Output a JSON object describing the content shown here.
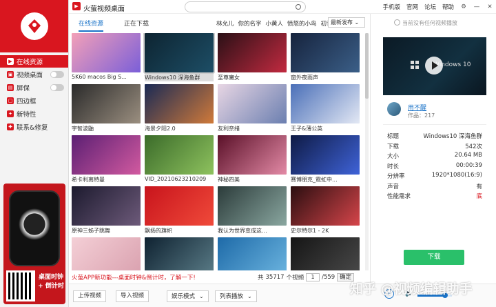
{
  "window": {
    "title": "火萤视频桌面",
    "search_placeholder": "",
    "nav": [
      "手机版",
      "官网",
      "论坛",
      "帮助"
    ],
    "controls": [
      "⚙",
      "—",
      "✕"
    ]
  },
  "sidebar": {
    "items": [
      {
        "label": "在线资源",
        "icon": "play-icon",
        "active": true,
        "toggle": false
      },
      {
        "label": "视频桌面",
        "icon": "video-icon",
        "active": false,
        "toggle": true
      },
      {
        "label": "屏保",
        "icon": "screensaver-icon",
        "active": false,
        "toggle": true
      },
      {
        "label": "四边框",
        "icon": "frame-icon",
        "active": false,
        "toggle": false
      },
      {
        "label": "新特性",
        "icon": "lightbulb-icon",
        "active": false,
        "toggle": false
      },
      {
        "label": "联系&修复",
        "icon": "wrench-icon",
        "active": false,
        "toggle": false
      }
    ],
    "promo_text": "桌面时钟 + 倒计时"
  },
  "tabs": {
    "items": [
      "在线资源",
      "正在下载"
    ],
    "authors": [
      "林允儿",
      "你的名字",
      "小黄人",
      "愤怒的小鸟",
      "初音"
    ],
    "sort": "最新发布"
  },
  "grid": {
    "tiles": [
      {
        "label": "5K60 macos Big S...",
        "colors": [
          "#f3a0b8",
          "#7b5fd8"
        ]
      },
      {
        "label": "Windows10 深海鱼群",
        "colors": [
          "#0d2431",
          "#1d4e66"
        ],
        "selected": true
      },
      {
        "label": "至尊魔女",
        "colors": [
          "#2a1016",
          "#c22a40"
        ]
      },
      {
        "label": "窗外夜雨声",
        "colors": [
          "#16233d",
          "#3b5f88"
        ]
      },
      {
        "label": "宇智波鼬",
        "colors": [
          "#2a2a2a",
          "#9b8f80"
        ]
      },
      {
        "label": "海景夕阳2.0",
        "colors": [
          "#1a2a55",
          "#d07a3a"
        ]
      },
      {
        "label": "友利奈绪",
        "colors": [
          "#e8d6e4",
          "#6b7fb0"
        ]
      },
      {
        "label": "王子&薄公英",
        "colors": [
          "#4a6fb8",
          "#e3e8f4"
        ]
      },
      {
        "label": "希卡利离特曼",
        "colors": [
          "#5b1f73",
          "#d25aa0"
        ]
      },
      {
        "label": "VID_20210623210209",
        "colors": [
          "#3b6b2a",
          "#8ec25e"
        ]
      },
      {
        "label": "神秘四美",
        "colors": [
          "#5a1028",
          "#e38aa6"
        ]
      },
      {
        "label": "赛博朋克_霓虹中...",
        "colors": [
          "#0e1a44",
          "#3f63d8"
        ]
      },
      {
        "label": "原神三姊子跳舞",
        "colors": [
          "#1c1a2e",
          "#6d5a7a"
        ]
      },
      {
        "label": "飘扬的旗帜",
        "colors": [
          "#c8141c",
          "#f04a3a"
        ]
      },
      {
        "label": "我认为世界变成这...",
        "colors": [
          "#2b3b3a",
          "#8aa7a0"
        ]
      },
      {
        "label": "史尔特尔1 - 2K",
        "colors": [
          "#2a0e10",
          "#d6454a"
        ]
      },
      {
        "label": "",
        "colors": [
          "#f4cfd6",
          "#d9a0ae"
        ]
      },
      {
        "label": "",
        "colors": [
          "#0f2231",
          "#5b7d88"
        ]
      },
      {
        "label": "",
        "colors": [
          "#1e6aa8",
          "#6cb5e0"
        ]
      },
      {
        "label": "",
        "colors": [
          "#151515",
          "#4a4a4a"
        ]
      }
    ]
  },
  "status": {
    "news": "火萤APP新功能---桌面时钟&倒计时，了解一下!",
    "total_prefix": "共",
    "total": "35717",
    "total_suffix": "个视频",
    "page": "1",
    "page_total": "/559",
    "jump": "确定"
  },
  "bottom": {
    "upload": "上传视频",
    "import": "导入视频",
    "mode": "娱乐模式",
    "playlist": "列表播放"
  },
  "panel": {
    "notice": "当前没有任何视频播放",
    "preview_text": "Windows 10",
    "author_name": "用不醒",
    "author_works": "作品：217",
    "info": [
      {
        "k": "标题",
        "v": "Windows10 深海鱼群"
      },
      {
        "k": "下载",
        "v": "542次"
      },
      {
        "k": "大小",
        "v": "20.64 MB"
      },
      {
        "k": "时长",
        "v": "00:00:39"
      },
      {
        "k": "分辨率",
        "v": "1920*1080(16:9)"
      },
      {
        "k": "声音",
        "v": "有"
      },
      {
        "k": "性能需求",
        "v": "底"
      }
    ],
    "download": "下载",
    "volume": 0.8
  },
  "watermark": "知乎 @视频编辑助手",
  "colors": {
    "brand": "#d9161f",
    "accent": "#1a73c8",
    "download": "#2ac06a"
  }
}
